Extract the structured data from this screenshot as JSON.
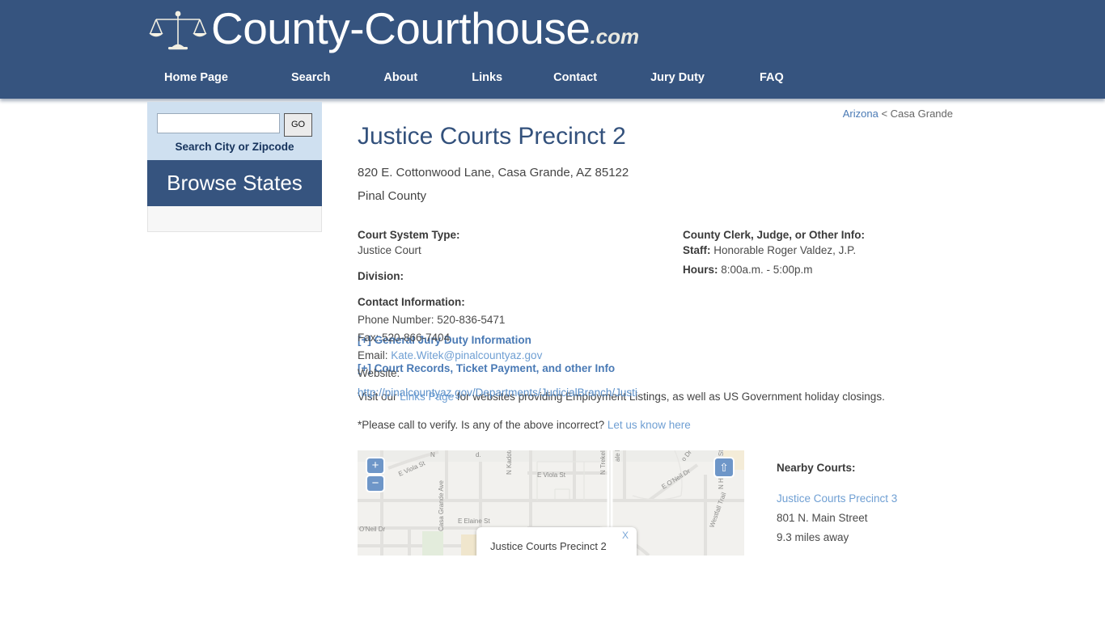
{
  "header": {
    "brand_name": "County-Courthouse",
    "brand_tld": ".com",
    "logo_icon": "scales-of-justice-icon",
    "nav": [
      {
        "label": "Home Page",
        "gap": 0
      },
      {
        "label": "Search",
        "gap": 78
      },
      {
        "label": "About",
        "gap": 66
      },
      {
        "label": "Links",
        "gap": 67
      },
      {
        "label": "Contact",
        "gap": 63
      },
      {
        "label": "Jury Duty",
        "gap": 66
      },
      {
        "label": "FAQ",
        "gap": 68
      }
    ]
  },
  "sidebar": {
    "search_value": "",
    "search_placeholder": "",
    "go_label": "GO",
    "search_caption": "Search City or Zipcode",
    "browse_states_label": "Browse States"
  },
  "breadcrumb": {
    "state": "Arizona",
    "separator": " < ",
    "city": "Casa Grande"
  },
  "main": {
    "title": "Justice Courts Precinct 2",
    "address": "820 E. Cottonwood Lane, Casa Grande, AZ 85122",
    "county": "Pinal County",
    "left_column": {
      "court_system_type_label": "Court System Type:",
      "court_system_type_value": "Justice Court",
      "division_label": "Division:",
      "division_value": "",
      "contact_label": "Contact Information:",
      "phone": "Phone Number: 520-836-5471",
      "fax": "Fax: 520-866-7404",
      "email_prefix": "Email: ",
      "email": "Kate.Witek@pinalcountyaz.gov",
      "website_label": "Website:",
      "website_url": "http://pinalcountyaz.gov/Departments/JudicialBranch/Justi"
    },
    "right_column": {
      "clerk_label": "County Clerk, Judge, or Other Info:",
      "staff_label": "Staff:",
      "staff_value": " Honorable Roger Valdez, J.P.",
      "hours_label": "Hours:",
      "hours_value": " 8:00a.m. - 5:00p.m"
    },
    "expanders": [
      {
        "label": "[+] General Jury Duty Information"
      },
      {
        "label": "[+] Court Records, Ticket Payment, and other Info"
      }
    ],
    "links_paragraph": {
      "before": "Visit our ",
      "link": "Links Page",
      "after": " for websites providing Employment Listings, as well as US Government holiday closings."
    },
    "verify_paragraph": {
      "before": "*Please call to verify. Is any of the above incorrect? ",
      "link": "Let us know here"
    }
  },
  "map": {
    "zoom_in_label": "+",
    "zoom_out_label": "−",
    "compass_icon": "north-arrow-icon",
    "compass_glyph": "⇧",
    "popup_title": "Justice Courts Precinct 2",
    "popup_close_label": "X",
    "street_labels": [
      "E Viola St",
      "E Viola St",
      "N Kadota Ave",
      "N Trekell Rd",
      "E O'Neil Dr",
      "N Hubbard St",
      "E Elaine St",
      "O'Neil Dr",
      "Casa Grande Ave",
      "Westfall Trail",
      "N Hubbard St",
      "ale Ln"
    ]
  },
  "nearby": {
    "title": "Nearby Courts:",
    "items": [
      {
        "name": "Justice Courts Precinct 3",
        "address": "801 N. Main Street",
        "distance": "9.3 miles away"
      }
    ]
  },
  "colors": {
    "header_blue": "#36547f",
    "accent_link": "#6f9fd3",
    "title_blue": "#33517c",
    "panel_blue": "#cfe0f0"
  }
}
